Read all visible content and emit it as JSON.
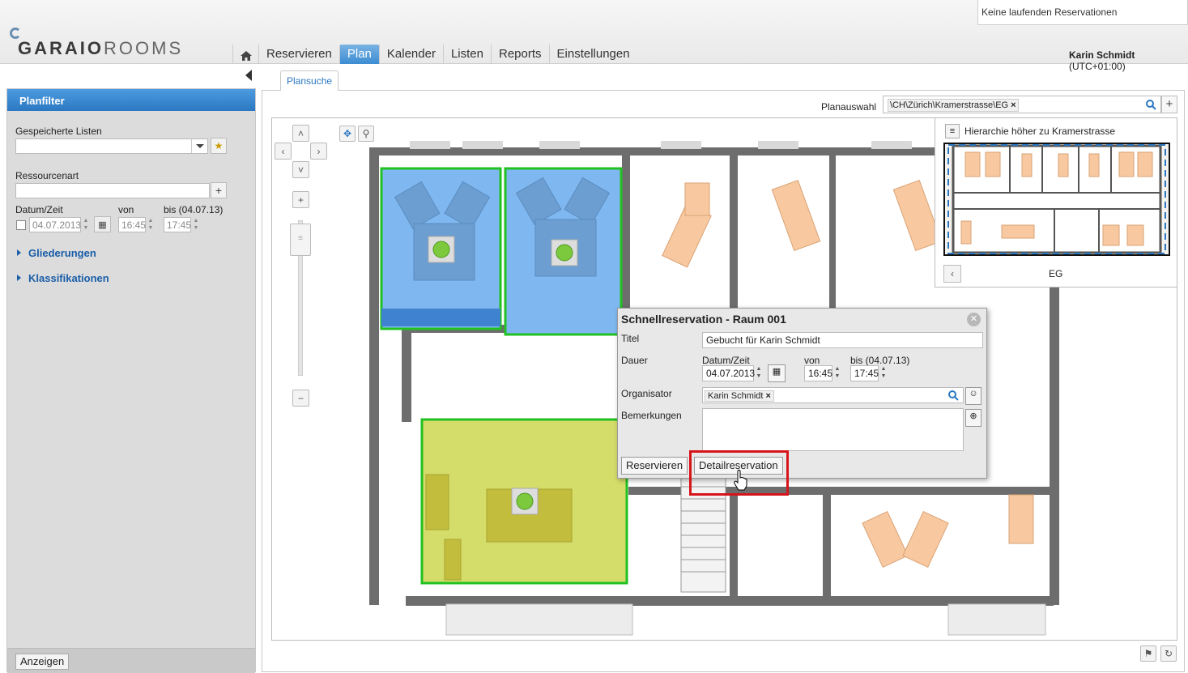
{
  "header": {
    "logo_bold": "GARAIO",
    "logo_light": "ROOMS",
    "reservation_status": "Keine laufenden Reservationen",
    "user_name": "Karin Schmidt",
    "user_tz": "(UTC+01:00)"
  },
  "nav": {
    "items": [
      {
        "label": "Reservieren"
      },
      {
        "label": "Plan"
      },
      {
        "label": "Kalender"
      },
      {
        "label": "Listen"
      },
      {
        "label": "Reports"
      },
      {
        "label": "Einstellungen"
      }
    ],
    "active": "Plan"
  },
  "sidebar": {
    "title": "Planfilter",
    "saved_lists_label": "Gespeicherte Listen",
    "resource_type_label": "Ressourcenart",
    "datetime_label": "Datum/Zeit",
    "from_label": "von",
    "to_label": "bis (04.07.13)",
    "date_value": "04.07.2013",
    "from_value": "16:45",
    "to_value": "17:45",
    "sections": [
      "Gliederungen",
      "Klassifikationen"
    ],
    "show_button": "Anzeigen"
  },
  "main": {
    "tab": "Plansuche",
    "plan_select_label": "Planauswahl",
    "plan_chip": "\\CH\\Zürich\\Kramerstrasse\\EG"
  },
  "overview": {
    "hierarchy_text": "Hierarchie höher zu Kramerstrasse",
    "floor": "EG"
  },
  "dialog": {
    "title": "Schnellreservation - Raum 001",
    "title_label": "Titel",
    "title_value": "Gebucht für Karin Schmidt",
    "duration_label": "Dauer",
    "datetime_label": "Datum/Zeit",
    "from_label": "von",
    "to_label": "bis (04.07.13)",
    "date_value": "04.07.2013",
    "from_value": "16:45",
    "to_value": "17:45",
    "organizer_label": "Organisator",
    "organizer_chip": "Karin Schmidt",
    "remarks_label": "Bemerkungen",
    "reserve_button": "Reservieren",
    "detail_button": "Detailreservation"
  },
  "colors": {
    "accent": "#2b78c2",
    "room_available": "#7fb8f0",
    "room_selected": "#d4dc6a",
    "room_border": "#22c122",
    "highlight": "#d6151b",
    "furniture": "#f8c9a0",
    "wall": "#666666"
  }
}
